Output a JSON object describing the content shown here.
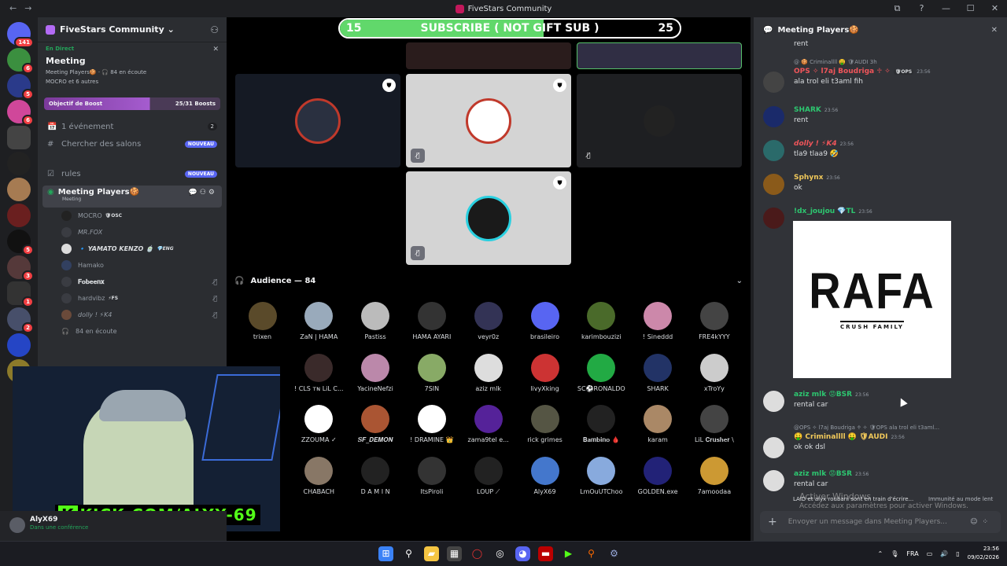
{
  "window": {
    "title": "FiveStars Community",
    "back_icon": "←",
    "forward_icon": "→",
    "controls": [
      "⧉",
      "?",
      "—",
      "☐",
      "✕"
    ]
  },
  "server_list": {
    "top_badge": "141",
    "badges": [
      "6",
      "5",
      "6",
      "5",
      "3",
      "1",
      "2",
      "1",
      "NO"
    ]
  },
  "sidebar": {
    "server_name": "FiveStars Community",
    "live": {
      "label": "En Direct",
      "title": "Meeting",
      "channel": "Meeting Players🍪 · 🎧 84 en écoute",
      "members": "MOCRO et 6 autres"
    },
    "boost": {
      "label": "Objectif de Boost",
      "progress": "25/31 Boosts"
    },
    "rows": [
      {
        "icon": "📅",
        "label": "1 événement",
        "count": "2"
      },
      {
        "icon": "#",
        "label": "Chercher des salons",
        "badge": "NOUVEAU"
      },
      {
        "icon": "☑",
        "label": "rules",
        "badge": "NOUVEAU"
      }
    ],
    "selected_channel": {
      "name": "Meeting Players🍪",
      "sub": "Meeting"
    },
    "members": [
      {
        "name": "MOCRO",
        "tag": "🛡OSC"
      },
      {
        "name": "MR.FOX",
        "tag": ""
      },
      {
        "name": "🔹 YAMATO KENZO 🍵",
        "tag": "💎ENG"
      },
      {
        "name": "𝐅𝐨𝐛𝐞𝐞𝐧𝐱",
        "tag": ""
      },
      {
        "name": "hardvibz",
        "tag": "⚡FS"
      },
      {
        "name": "dolly ! ⚡K4",
        "tag": ""
      }
    ],
    "listeners": "84 en écoute",
    "user": {
      "name": "AlyX69",
      "status": "Dans une conférence"
    }
  },
  "stage": {
    "sub_goal": {
      "current": "15",
      "text": "SUBSCRIBE ( NOT GIFT SUB )",
      "target": "25",
      "progress": 0.6
    },
    "audience_title": "Audience — 84",
    "audience": [
      "trixen",
      "ZaN | HAMA",
      "Pastiss",
      "HAMA AYARI",
      "veyr0z",
      "brasileiro",
      "karimbouzizi",
      "! Sineddd",
      "FRE4kYYY",
      "",
      "! CLS ᴛɴ LiL C...",
      "YacineNefzi",
      "7SIN",
      "aziz mlk",
      "livyXking",
      "SC⚽RONALDO",
      "SHARK",
      "xTroYy",
      "",
      "ZZOUMA ✓",
      "𝑺𝑭_𝑫𝑬𝑴𝑶𝑵",
      "! DRAMINE 👑",
      "zama9tel e...",
      "rick grimes",
      "𝐁𝐚𝐦𝐛𝐢𝐧𝐨 🩸",
      "karam",
      "LiL 𝐂𝐫𝐮𝐬𝐡𝐞𝐫 \\",
      "",
      "CHABACH",
      "D A M I N",
      "ItsPiroli",
      "LOUP ⟋",
      "AlyX69",
      "LmOuUTChoo",
      "GOLDEN.exe",
      "7amoodaa"
    ],
    "stream_overlay": "KICK.COM/ALYX-69"
  },
  "chat": {
    "title": "Meeting Players🍪",
    "messages": [
      {
        "author": "",
        "time": "",
        "text": "rent",
        "reply": ""
      },
      {
        "author": "OPS ✧ l7aj Boudriga ♱ ✧",
        "time": "23:56",
        "text": "ala trol eli t3aml fih",
        "reply": "@ 🍪 Criminallll 🤑 🛡AUDI 3h"
      },
      {
        "author": "SHARK",
        "time": "23:56",
        "text": "rent",
        "reply": ""
      },
      {
        "author": "dolly ! ⚡K4",
        "time": "23:56",
        "text": "tla9 tlaa9 🤣",
        "reply": ""
      },
      {
        "author": "Sphynx",
        "time": "23:56",
        "text": "ok",
        "reply": ""
      },
      {
        "author": "!dx_joujou 💎TL",
        "time": "23:56",
        "text": "",
        "reply": ""
      },
      {
        "author": "aziz mlk 😡BSR",
        "time": "23:56",
        "text": "rental car",
        "reply": ""
      },
      {
        "author": "🤑 Criminallll 🤑 🛡AUDI",
        "time": "23:56",
        "text": "ok ok dsl",
        "reply": "@OPS ✧ l7aj Boudriga ♱ ✧ 🛡OPS ala trol eli t3aml..."
      },
      {
        "author": "aziz mlk 😡BSR",
        "time": "23:56",
        "text": "rental car",
        "reply": ""
      }
    ],
    "image": {
      "big": "RAFA",
      "small": "CRUSH FAMILY"
    },
    "typing": "LAID et alyx roubani sont en train d'écrire...",
    "slowmode": "Immunité au mode lent",
    "placeholder": "Envoyer un message dans Meeting Players...",
    "watermark_line1": "Activer Windows",
    "watermark_line2": "Accédez aux paramètres pour activer Windows."
  },
  "taskbar": {
    "lang": "FRA",
    "time": "23:56",
    "date": "09/02/2026",
    "badge": "99"
  }
}
